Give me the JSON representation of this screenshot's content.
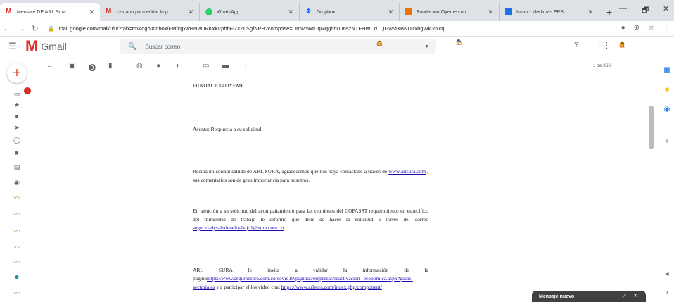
{
  "browser": {
    "tabs": [
      {
        "title": "Mensaje DE ARL Sura |",
        "icon": "gmail-icon"
      },
      {
        "title": "Usuario para editar la p",
        "icon": "gmail-icon"
      },
      {
        "title": "WhatsApp",
        "icon": "whatsapp-icon"
      },
      {
        "title": "Dropbox",
        "icon": "dropbox-icon"
      },
      {
        "title": "Fundación Óyeme con",
        "icon": "fundacion-icon"
      },
      {
        "title": "Inicio - Medimás EPS",
        "icon": "medimas-icon"
      }
    ],
    "url": "mail.google.com/mail/u/0/?tab=rm&ogbl#inbox/FMfcgxwHNWJRKxkVpbbFlZcZLSgfNPB?compose=DmwnWtDqMqgbrTLmszNTFHWCdTQGwMXBNDTxhgWkJcxcql...",
    "window_controls": [
      "—",
      "🗗",
      "✕"
    ]
  },
  "gmail": {
    "app_name": "Gmail",
    "search_placeholder": "Buscar correo",
    "message_count": "1 de 366",
    "compose_minimized_label": "Mensaje nuevo"
  },
  "email": {
    "org": "FUNDACION OYEME",
    "subject": "Asunto: Respuesta a su solicitud",
    "para1_pre": "Reciba un cordial saludo de ARL SURA, agradecemos que nos haya contactado a través de ",
    "para1_link": "www.arlsura.com",
    "para1_post": " , sus comentarios son de gran importancia para nosotros.",
    "para2_pre": "En atención a su solicitud del acompañamiento para las reuniones del COPASST requerimiento en específico del ministerio de trabajo le informo que debe de hacer la solicitud a través del correo ",
    "para2_link": "seguridadysaludeneltrabajo1@sura.com.co",
    "para3_pre": "ARL SURA le invita a validar la información de la pagina",
    "para3_link": "https://www.segurossura.com.co/covid19/paginas/empresas/reactivacion--economica.aspx#guias-sectoriales",
    "para3_mid": " y a participar el los video chat ",
    "para3_link2": "https://www.arlsura.com/index.php/component/"
  },
  "colors": {
    "gmail_red": "#d93025",
    "link": "#1a0dab",
    "compose_bar": "#404040"
  }
}
